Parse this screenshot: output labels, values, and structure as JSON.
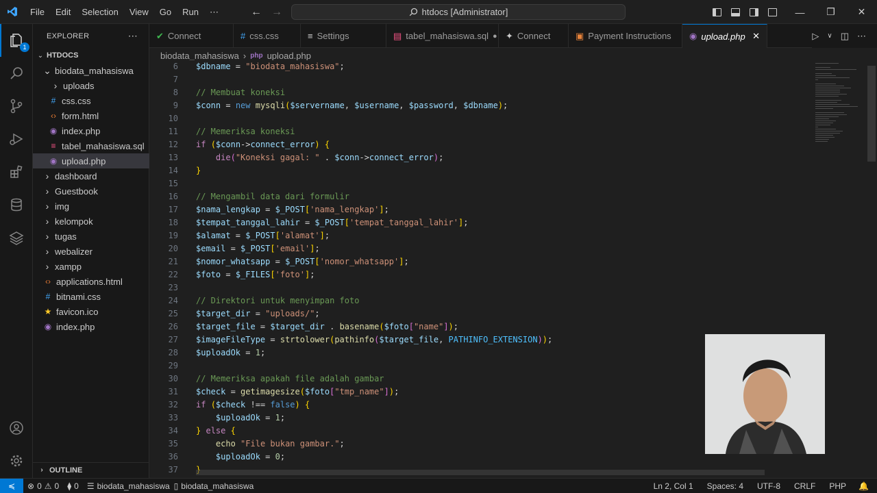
{
  "titlebar": {
    "menu": [
      "File",
      "Edit",
      "Selection",
      "View",
      "Go",
      "Run",
      "⋯"
    ],
    "search": "htdocs [Administrator]"
  },
  "explorer": {
    "header": "EXPLORER",
    "root": "HTDOCS",
    "items": [
      {
        "label": "biodata_mahasiswa",
        "icon": "chevron-down",
        "kind": "folder-open"
      },
      {
        "label": "uploads",
        "icon": "chevron-right",
        "kind": "folder"
      },
      {
        "label": "css.css",
        "icon": "#",
        "kind": "css"
      },
      {
        "label": "form.html",
        "icon": "<>",
        "kind": "html"
      },
      {
        "label": "index.php",
        "icon": "php",
        "kind": "php"
      },
      {
        "label": "tabel_mahasiswa.sql",
        "icon": "db",
        "kind": "sql"
      },
      {
        "label": "upload.php",
        "icon": "php",
        "kind": "php"
      },
      {
        "label": "dashboard",
        "icon": "chevron-right",
        "kind": "folder"
      },
      {
        "label": "Guestbook",
        "icon": "chevron-right",
        "kind": "folder"
      },
      {
        "label": "img",
        "icon": "chevron-right",
        "kind": "folder"
      },
      {
        "label": "kelompok",
        "icon": "chevron-right",
        "kind": "folder"
      },
      {
        "label": "tugas",
        "icon": "chevron-right",
        "kind": "folder"
      },
      {
        "label": "webalizer",
        "icon": "chevron-right",
        "kind": "folder"
      },
      {
        "label": "xampp",
        "icon": "chevron-right",
        "kind": "folder"
      },
      {
        "label": "applications.html",
        "icon": "<>",
        "kind": "html"
      },
      {
        "label": "bitnami.css",
        "icon": "#",
        "kind": "css"
      },
      {
        "label": "favicon.ico",
        "icon": "star",
        "kind": "ico"
      },
      {
        "label": "index.php",
        "icon": "php",
        "kind": "php"
      }
    ],
    "outline": "OUTLINE",
    "badge": "1"
  },
  "tabs": [
    {
      "label": "Connect",
      "kind": "connect-check"
    },
    {
      "label": "css.css",
      "kind": "css"
    },
    {
      "label": "Settings",
      "kind": "settings"
    },
    {
      "label": "tabel_mahasiswa.sql",
      "kind": "sql",
      "dirty": true
    },
    {
      "label": "Connect",
      "kind": "connect"
    },
    {
      "label": "Payment Instructions",
      "kind": "payment"
    },
    {
      "label": "upload.php",
      "kind": "php",
      "active": true
    }
  ],
  "breadcrumb": {
    "folder": "biodata_mahasiswa",
    "file": "upload.php"
  },
  "code": [
    {
      "n": "6",
      "t": [
        [
          "var",
          "$dbname"
        ],
        [
          "op",
          " = "
        ],
        [
          "str",
          "\"biodata_mahasiswa\""
        ],
        [
          "op",
          ";"
        ]
      ]
    },
    {
      "n": "7",
      "t": []
    },
    {
      "n": "8",
      "t": [
        [
          "cm",
          "// Membuat koneksi"
        ]
      ]
    },
    {
      "n": "9",
      "t": [
        [
          "var",
          "$conn"
        ],
        [
          "op",
          " = "
        ],
        [
          "kw2",
          "new"
        ],
        [
          "op",
          " "
        ],
        [
          "fn",
          "mysqli"
        ],
        [
          "br",
          "("
        ],
        [
          "var",
          "$servername"
        ],
        [
          "op",
          ", "
        ],
        [
          "var",
          "$username"
        ],
        [
          "op",
          ", "
        ],
        [
          "var",
          "$password"
        ],
        [
          "op",
          ", "
        ],
        [
          "var",
          "$dbname"
        ],
        [
          "br",
          ")"
        ],
        [
          "op",
          ";"
        ]
      ]
    },
    {
      "n": "10",
      "t": []
    },
    {
      "n": "11",
      "t": [
        [
          "cm",
          "// Memeriksa koneksi"
        ]
      ]
    },
    {
      "n": "12",
      "t": [
        [
          "kw",
          "if"
        ],
        [
          "op",
          " "
        ],
        [
          "br",
          "("
        ],
        [
          "var",
          "$conn"
        ],
        [
          "op",
          "->"
        ],
        [
          "var",
          "connect_error"
        ],
        [
          "br",
          ")"
        ],
        [
          "op",
          " "
        ],
        [
          "br",
          "{"
        ]
      ]
    },
    {
      "n": "13",
      "t": [
        [
          "op",
          "    "
        ],
        [
          "kw",
          "die"
        ],
        [
          "br2",
          "("
        ],
        [
          "str",
          "\"Koneksi gagal: \""
        ],
        [
          "op",
          " . "
        ],
        [
          "var",
          "$conn"
        ],
        [
          "op",
          "->"
        ],
        [
          "var",
          "connect_error"
        ],
        [
          "br2",
          ")"
        ],
        [
          "op",
          ";"
        ]
      ]
    },
    {
      "n": "14",
      "t": [
        [
          "br",
          "}"
        ]
      ]
    },
    {
      "n": "15",
      "t": []
    },
    {
      "n": "16",
      "t": [
        [
          "cm",
          "// Mengambil data dari formulir"
        ]
      ]
    },
    {
      "n": "17",
      "t": [
        [
          "var",
          "$nama_lengkap"
        ],
        [
          "op",
          " = "
        ],
        [
          "var",
          "$_POST"
        ],
        [
          "br",
          "["
        ],
        [
          "str",
          "'nama_lengkap'"
        ],
        [
          "br",
          "]"
        ],
        [
          "op",
          ";"
        ]
      ]
    },
    {
      "n": "18",
      "t": [
        [
          "var",
          "$tempat_tanggal_lahir"
        ],
        [
          "op",
          " = "
        ],
        [
          "var",
          "$_POST"
        ],
        [
          "br",
          "["
        ],
        [
          "str",
          "'tempat_tanggal_lahir'"
        ],
        [
          "br",
          "]"
        ],
        [
          "op",
          ";"
        ]
      ]
    },
    {
      "n": "19",
      "t": [
        [
          "var",
          "$alamat"
        ],
        [
          "op",
          " = "
        ],
        [
          "var",
          "$_POST"
        ],
        [
          "br",
          "["
        ],
        [
          "str",
          "'alamat'"
        ],
        [
          "br",
          "]"
        ],
        [
          "op",
          ";"
        ]
      ]
    },
    {
      "n": "20",
      "t": [
        [
          "var",
          "$email"
        ],
        [
          "op",
          " = "
        ],
        [
          "var",
          "$_POST"
        ],
        [
          "br",
          "["
        ],
        [
          "str",
          "'email'"
        ],
        [
          "br",
          "]"
        ],
        [
          "op",
          ";"
        ]
      ]
    },
    {
      "n": "21",
      "t": [
        [
          "var",
          "$nomor_whatsapp"
        ],
        [
          "op",
          " = "
        ],
        [
          "var",
          "$_POST"
        ],
        [
          "br",
          "["
        ],
        [
          "str",
          "'nomor_whatsapp'"
        ],
        [
          "br",
          "]"
        ],
        [
          "op",
          ";"
        ]
      ]
    },
    {
      "n": "22",
      "t": [
        [
          "var",
          "$foto"
        ],
        [
          "op",
          " = "
        ],
        [
          "var",
          "$_FILES"
        ],
        [
          "br",
          "["
        ],
        [
          "str",
          "'foto'"
        ],
        [
          "br",
          "]"
        ],
        [
          "op",
          ";"
        ]
      ]
    },
    {
      "n": "23",
      "t": []
    },
    {
      "n": "24",
      "t": [
        [
          "cm",
          "// Direktori untuk menyimpan foto"
        ]
      ]
    },
    {
      "n": "25",
      "t": [
        [
          "var",
          "$target_dir"
        ],
        [
          "op",
          " = "
        ],
        [
          "str",
          "\"uploads/\""
        ],
        [
          "op",
          ";"
        ]
      ]
    },
    {
      "n": "26",
      "t": [
        [
          "var",
          "$target_file"
        ],
        [
          "op",
          " = "
        ],
        [
          "var",
          "$target_dir"
        ],
        [
          "op",
          " . "
        ],
        [
          "fn",
          "basename"
        ],
        [
          "br",
          "("
        ],
        [
          "var",
          "$foto"
        ],
        [
          "br2",
          "["
        ],
        [
          "str",
          "\"name\""
        ],
        [
          "br2",
          "]"
        ],
        [
          "br",
          ")"
        ],
        [
          "op",
          ";"
        ]
      ]
    },
    {
      "n": "27",
      "t": [
        [
          "var",
          "$imageFileType"
        ],
        [
          "op",
          " = "
        ],
        [
          "fn",
          "strtolower"
        ],
        [
          "br",
          "("
        ],
        [
          "fn",
          "pathinfo"
        ],
        [
          "br2",
          "("
        ],
        [
          "var",
          "$target_file"
        ],
        [
          "op",
          ", "
        ],
        [
          "const",
          "PATHINFO_EXTENSION"
        ],
        [
          "br2",
          ")"
        ],
        [
          "br",
          ")"
        ],
        [
          "op",
          ";"
        ]
      ]
    },
    {
      "n": "28",
      "t": [
        [
          "var",
          "$uploadOk"
        ],
        [
          "op",
          " = "
        ],
        [
          "num",
          "1"
        ],
        [
          "op",
          ";"
        ]
      ]
    },
    {
      "n": "29",
      "t": []
    },
    {
      "n": "30",
      "t": [
        [
          "cm",
          "// Memeriksa apakah file adalah gambar"
        ]
      ]
    },
    {
      "n": "31",
      "t": [
        [
          "var",
          "$check"
        ],
        [
          "op",
          " = "
        ],
        [
          "fn",
          "getimagesize"
        ],
        [
          "br",
          "("
        ],
        [
          "var",
          "$foto"
        ],
        [
          "br2",
          "["
        ],
        [
          "str",
          "\"tmp_name\""
        ],
        [
          "br2",
          "]"
        ],
        [
          "br",
          ")"
        ],
        [
          "op",
          ";"
        ]
      ]
    },
    {
      "n": "32",
      "t": [
        [
          "kw",
          "if"
        ],
        [
          "op",
          " "
        ],
        [
          "br",
          "("
        ],
        [
          "var",
          "$check"
        ],
        [
          "op",
          " !== "
        ],
        [
          "kw2",
          "false"
        ],
        [
          "br",
          ")"
        ],
        [
          "op",
          " "
        ],
        [
          "br",
          "{"
        ]
      ]
    },
    {
      "n": "33",
      "t": [
        [
          "op",
          "    "
        ],
        [
          "var",
          "$uploadOk"
        ],
        [
          "op",
          " = "
        ],
        [
          "num",
          "1"
        ],
        [
          "op",
          ";"
        ]
      ]
    },
    {
      "n": "34",
      "t": [
        [
          "br",
          "}"
        ],
        [
          "op",
          " "
        ],
        [
          "kw",
          "else"
        ],
        [
          "op",
          " "
        ],
        [
          "br",
          "{"
        ]
      ]
    },
    {
      "n": "35",
      "t": [
        [
          "op",
          "    "
        ],
        [
          "fn",
          "echo"
        ],
        [
          "op",
          " "
        ],
        [
          "str",
          "\"File bukan gambar.\""
        ],
        [
          "op",
          ";"
        ]
      ]
    },
    {
      "n": "36",
      "t": [
        [
          "op",
          "    "
        ],
        [
          "var",
          "$uploadOk"
        ],
        [
          "op",
          " = "
        ],
        [
          "num",
          "0"
        ],
        [
          "op",
          ";"
        ]
      ]
    },
    {
      "n": "37",
      "t": [
        [
          "br",
          "}"
        ]
      ]
    }
  ],
  "status": {
    "errors": "0",
    "warnings": "0",
    "ports": "0",
    "branch1": "biodata_mahasiswa",
    "branch2": "biodata_mahasiswa",
    "position": "Ln 2, Col 1",
    "spaces": "Spaces: 4",
    "encoding": "UTF-8",
    "eol": "CRLF",
    "language": "PHP"
  },
  "colors": {
    "accent": "#0078d4",
    "php": "#a074c4",
    "css": "#42a5f5",
    "html": "#e37933",
    "sql": "#f55385"
  }
}
